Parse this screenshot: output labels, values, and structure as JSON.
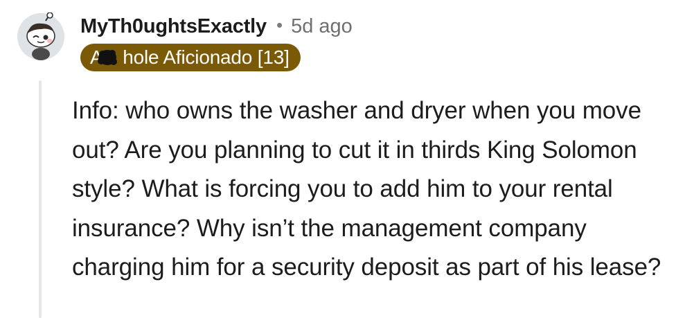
{
  "comment": {
    "author": "MyTh0ughtsExactly",
    "separator": "•",
    "timestamp": "5d ago",
    "flair": {
      "text": "A    hole Aficionado [13]",
      "background_color": "#7a5a06",
      "text_color": "#ffffff"
    },
    "avatar_icon": "snoo-avatar-icon",
    "body": "Info: who owns the washer and dryer when you move out? Are you planning to cut it in thirds King Solomon style? What is forcing you to add him to your rental insurance? Why isn’t the management company charging him for a security deposit as part of his lease?"
  }
}
